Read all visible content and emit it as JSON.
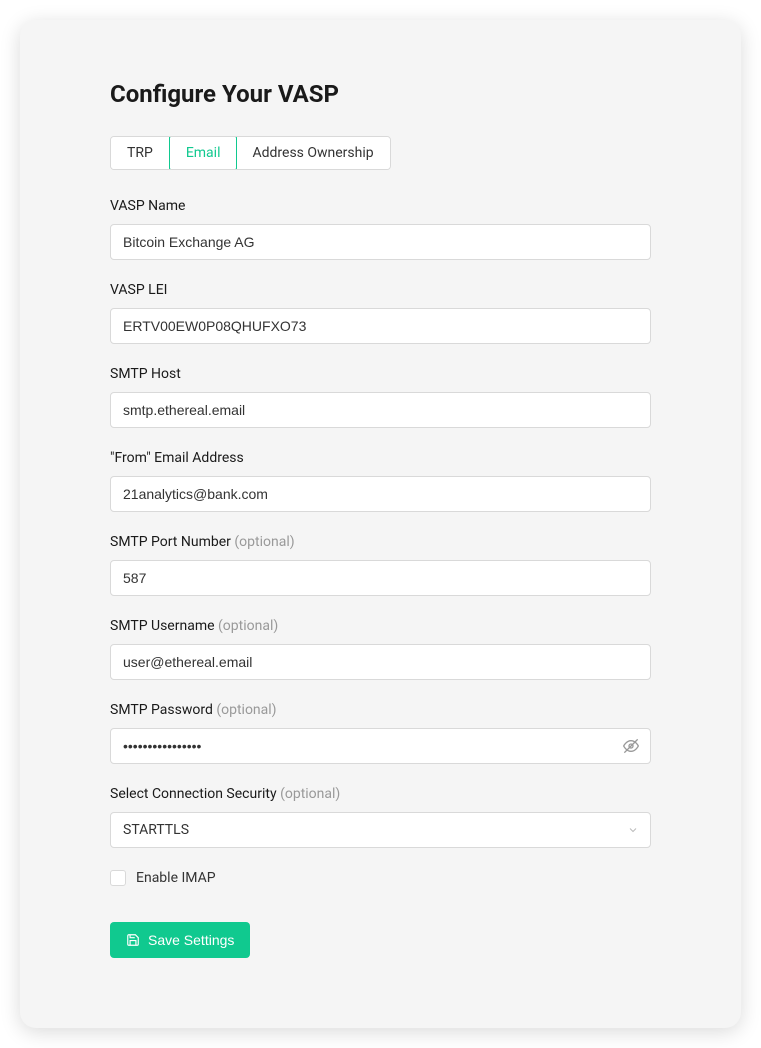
{
  "header": {
    "title": "Configure Your VASP"
  },
  "tabs": {
    "trp": "TRP",
    "email": "Email",
    "addressOwnership": "Address Ownership"
  },
  "fields": {
    "vaspName": {
      "label": "VASP Name",
      "value": "Bitcoin Exchange AG"
    },
    "vaspLei": {
      "label": "VASP LEI",
      "value": "ERTV00EW0P08QHUFXO73"
    },
    "smtpHost": {
      "label": "SMTP Host",
      "value": "smtp.ethereal.email"
    },
    "fromEmail": {
      "label": "\"From\" Email Address",
      "value": "21analytics@bank.com"
    },
    "smtpPort": {
      "label": "SMTP Port Number",
      "optional": "(optional)",
      "value": "587"
    },
    "smtpUsername": {
      "label": "SMTP Username",
      "optional": "(optional)",
      "value": "user@ethereal.email"
    },
    "smtpPassword": {
      "label": "SMTP Password",
      "optional": "(optional)",
      "value": "••••••••••••••••"
    },
    "connectionSecurity": {
      "label": "Select Connection Security",
      "optional": "(optional)",
      "value": "STARTTLS"
    },
    "enableImap": {
      "label": "Enable IMAP"
    }
  },
  "actions": {
    "save": "Save Settings"
  }
}
